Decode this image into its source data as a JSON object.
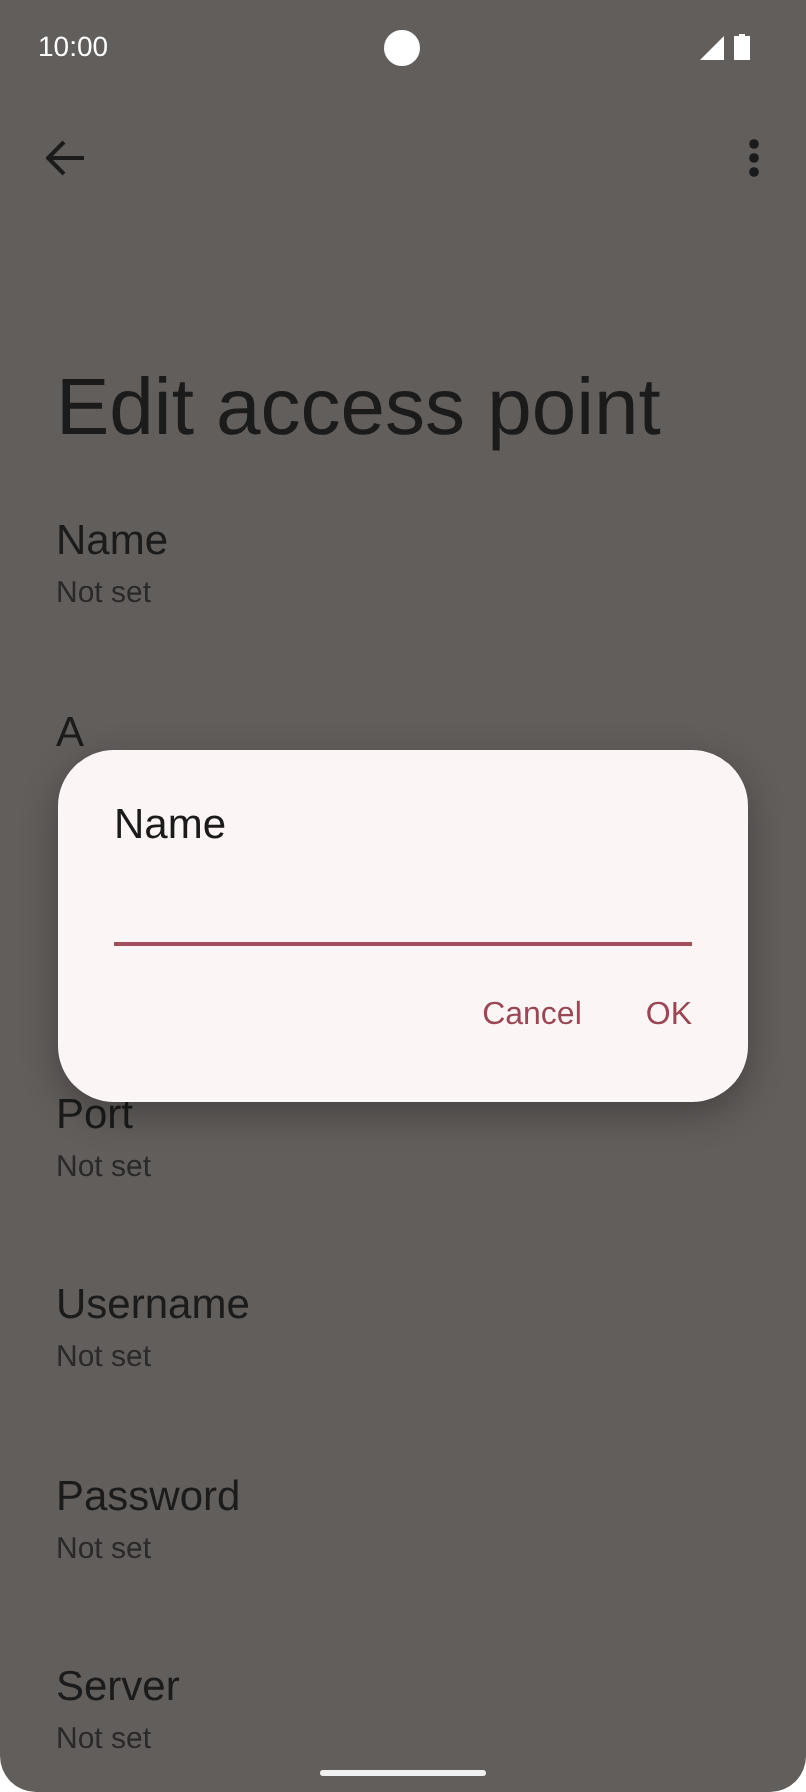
{
  "status_bar": {
    "time": "10:00"
  },
  "title": "Edit access point",
  "items": [
    {
      "title": "Name",
      "summary": "Not set"
    },
    {
      "title": "A"
    },
    {
      "title": "Port",
      "summary": "Not set"
    },
    {
      "title": "Username",
      "summary": "Not set"
    },
    {
      "title": "Password",
      "summary": "Not set"
    },
    {
      "title": "Server",
      "summary": "Not set"
    }
  ],
  "dialog": {
    "title": "Name",
    "buttons": [
      "Cancel",
      "OK"
    ]
  }
}
